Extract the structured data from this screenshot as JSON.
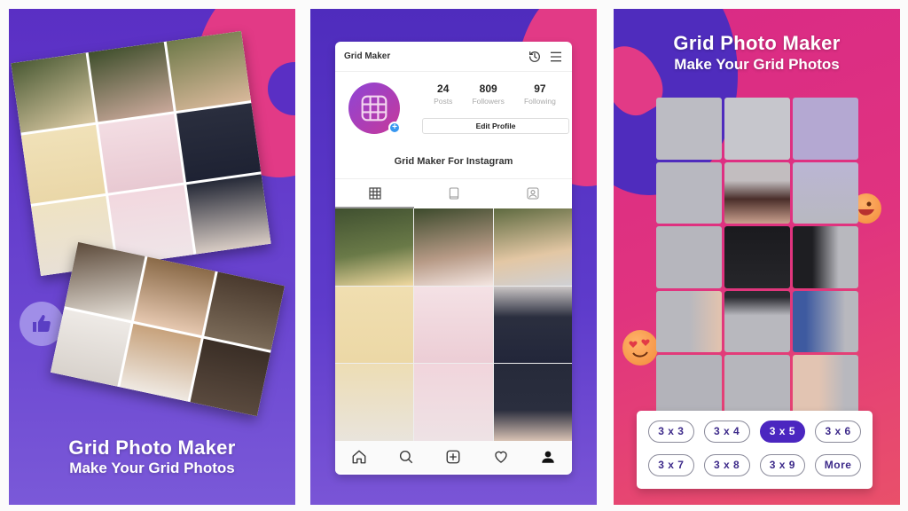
{
  "panels": [
    {
      "id": "promo-left",
      "headline": "Grid Photo Maker",
      "subheadline": "Make Your Grid Photos",
      "photos": [
        {
          "subject": "three women in dresses",
          "grid": "3x3"
        },
        {
          "subject": "bride portrait",
          "grid": "3x2"
        }
      ],
      "badge_icon": "thumbs-up-icon"
    },
    {
      "id": "promo-middle",
      "app": {
        "title": "Grid Maker",
        "header_icons": [
          "history-icon",
          "menu-icon"
        ],
        "profile": {
          "name": "Grid Maker For Instagram",
          "stats": [
            {
              "value": "24",
              "label": "Posts"
            },
            {
              "value": "809",
              "label": "Followers"
            },
            {
              "value": "97",
              "label": "Following"
            }
          ],
          "edit_label": "Edit Profile"
        },
        "tabs": [
          {
            "icon": "grid-icon",
            "active": true
          },
          {
            "icon": "igtv-icon",
            "active": false
          },
          {
            "icon": "tagged-icon",
            "active": false
          }
        ],
        "bottom_nav": [
          "home-icon",
          "search-icon",
          "add-post-icon",
          "heart-icon",
          "profile-icon"
        ]
      }
    },
    {
      "id": "promo-right",
      "headline": "Grid Photo Maker",
      "subheadline": "Make Your Grid Photos",
      "preview_grid": "3x5",
      "grid_sizes": [
        {
          "label": "3 x 3",
          "selected": false
        },
        {
          "label": "3 x 4",
          "selected": false
        },
        {
          "label": "3 x 5",
          "selected": true
        },
        {
          "label": "3 x 6",
          "selected": false
        },
        {
          "label": "3 x 7",
          "selected": false
        },
        {
          "label": "3 x 8",
          "selected": false
        },
        {
          "label": "3 x 9",
          "selected": false
        },
        {
          "label": "More",
          "selected": false
        }
      ]
    }
  ],
  "colors": {
    "purple": "#5a2fc4",
    "pink": "#e23a86",
    "selected_chip": "#4b26c0",
    "ig_blue": "#3897f0"
  }
}
